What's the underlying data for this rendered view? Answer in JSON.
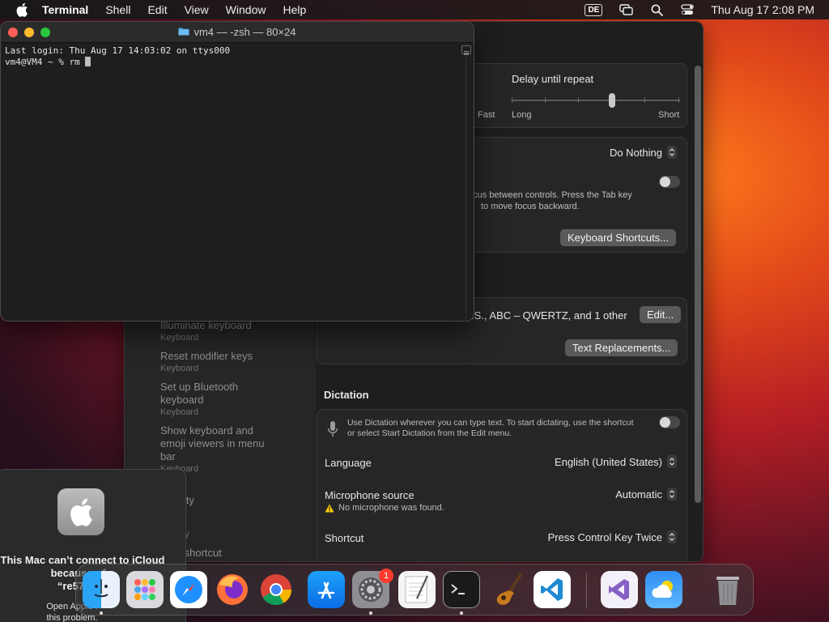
{
  "menubar": {
    "app_name": "Terminal",
    "menus": [
      "Shell",
      "Edit",
      "View",
      "Window",
      "Help"
    ],
    "input_badge": "DE",
    "clock": "Thu Aug 17  2:08 PM"
  },
  "terminal": {
    "title": "vm4 — -zsh — 80×24",
    "line1": "Last login: Thu Aug 17 14:03:02 on ttys000",
    "prompt": "vm4@VM4 ~ % rm "
  },
  "settings": {
    "sidebar": [
      {
        "title": "Illuminate keyboard",
        "sub": "Keyboard"
      },
      {
        "title": "Reset modifier keys",
        "sub": "Keyboard"
      },
      {
        "title": "Set up Bluetooth keyboard",
        "sub": "Keyboard"
      },
      {
        "title": "Show keyboard and emoji viewers in menu bar",
        "sub": "Keyboard"
      },
      {
        "title": "ssibility",
        "sub": ""
      },
      {
        "title": "oard",
        "sub": "ssibility"
      },
      {
        "title": "oard shortcut",
        "sub": ""
      }
    ],
    "repeat": {
      "delay_label": "Delay until repeat",
      "fast": "Fast",
      "long": "Long",
      "short": "Short",
      "delay_level": 0.6
    },
    "fn_popup": "Do Nothing",
    "tab_desc_1": "ocus between controls. Press the Tab key",
    "tab_desc_2": "to move focus backward.",
    "keyboard_shortcuts_btn": "Keyboard Shortcuts...",
    "input_sources": ".S., ABC – QWERTZ, and 1 other",
    "edit_btn": "Edit...",
    "text_replacements_btn": "Text Replacements...",
    "dictation": {
      "heading": "Dictation",
      "desc_1": "Use Dictation wherever you can type text. To start dictating, use the shortcut",
      "desc_2": "or select Start Dictation from the Edit menu.",
      "language_label": "Language",
      "language_value": "English (United States)",
      "mic_label": "Microphone source",
      "mic_value": "Automatic",
      "mic_warning": "No microphone was found.",
      "shortcut_label": "Shortcut",
      "shortcut_value": "Press Control Key Twice"
    }
  },
  "alert": {
    "title_1": "This Mac can’t connect to iCloud",
    "title_2": "because of a",
    "title_3": "“re579082",
    "body_1": "Open Apple I",
    "body_2": "this problem."
  },
  "dock": {
    "apps": [
      "Finder",
      "Launchpad",
      "Safari",
      "Firefox",
      "Chrome",
      "App Store",
      "System Settings",
      "TextEdit",
      "Terminal",
      "GarageBand",
      "Visual Studio Code",
      "Visual Studio",
      "Weather",
      "Trash"
    ],
    "settings_badge": "1"
  },
  "colors": {
    "accent_red": "#ff3b30",
    "warning_yellow": "#ffcc00"
  }
}
